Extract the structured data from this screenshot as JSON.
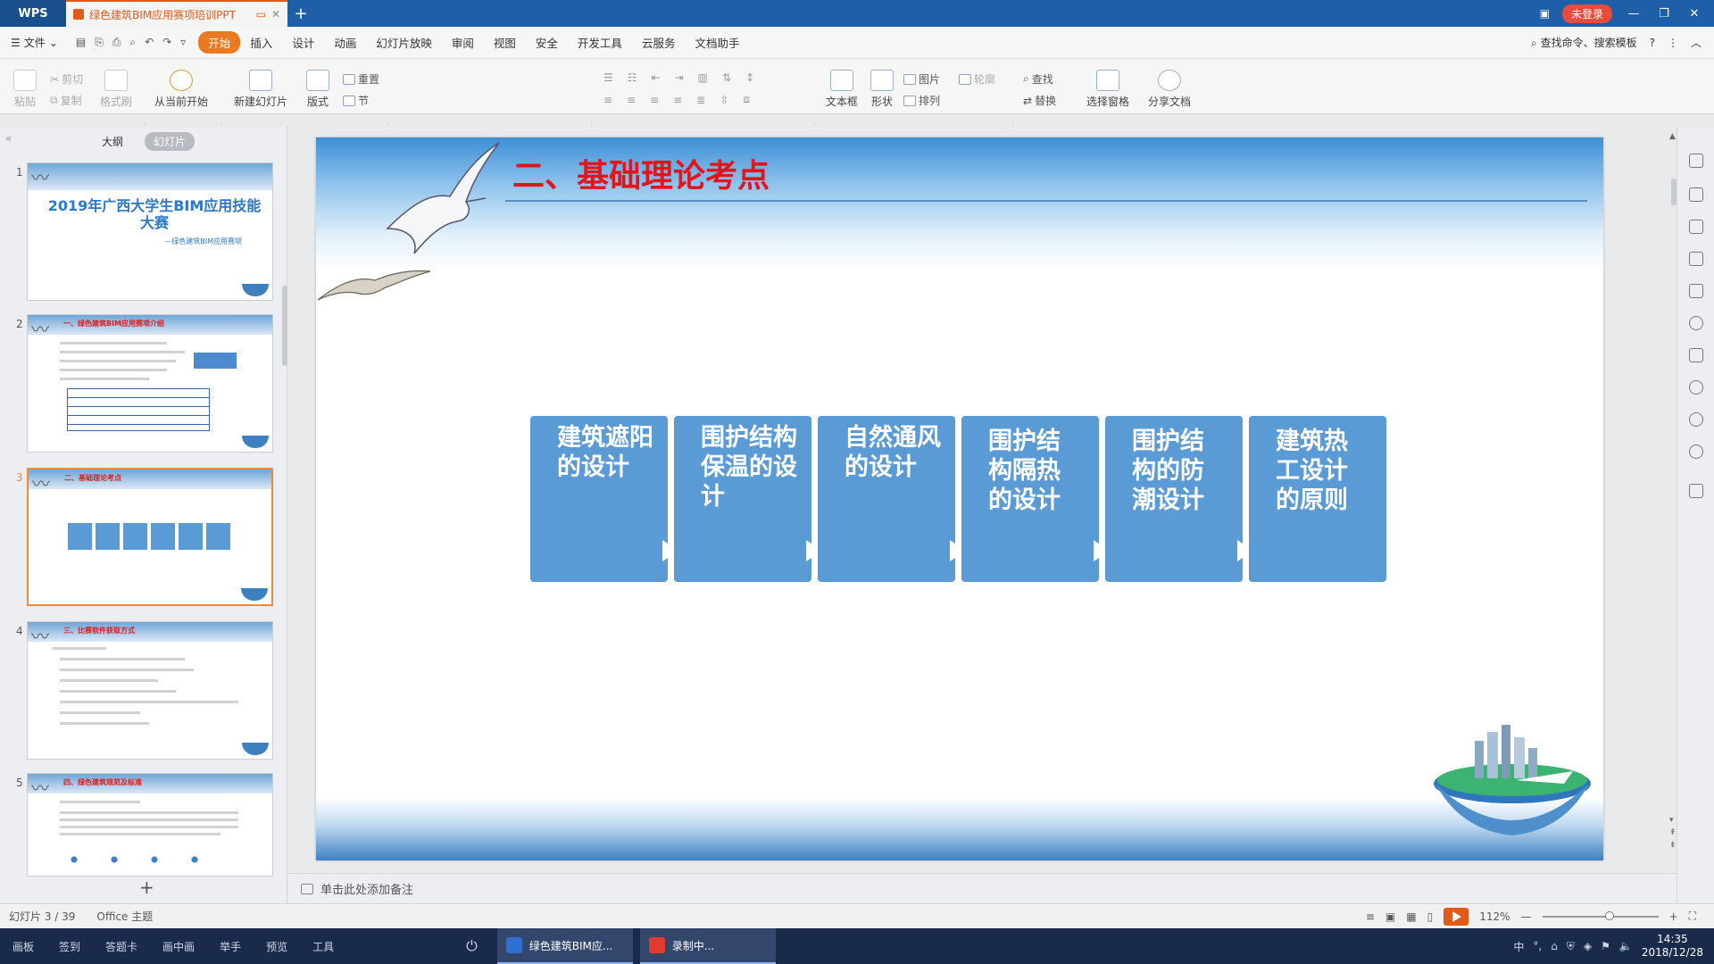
{
  "titlebar": {
    "app": "WPS",
    "doc_tab": "绿色建筑BIM应用赛项培训PPT",
    "login": "未登录"
  },
  "menu": {
    "file": "文件",
    "items": [
      "开始",
      "插入",
      "设计",
      "动画",
      "幻灯片放映",
      "审阅",
      "视图",
      "安全",
      "开发工具",
      "云服务",
      "文档助手"
    ],
    "search_cmd": "查找命令、搜索模板"
  },
  "ribbon": {
    "paste": "粘贴",
    "cut": "剪切",
    "copy": "复制",
    "format_painter": "格式刷",
    "from_current": "从当前开始",
    "new_slide": "新建幻灯片",
    "layout": "版式",
    "reset": "重置",
    "section": "节",
    "font_size": "0",
    "text_box": "文本框",
    "shape": "形状",
    "picture": "图片",
    "arrange": "排列",
    "outline": "轮廓",
    "find": "查找",
    "replace": "替换",
    "select_pane": "选择窗格",
    "share": "分享文档"
  },
  "left_panel": {
    "tab_outline": "大纲",
    "tab_slides": "幻灯片",
    "thumb1_title": "2019年广西大学生BIM应用技能大赛",
    "thumb1_sub": "—绿色建筑BIM应用赛项",
    "thumb2_title": "一、绿色建筑BIM应用赛项介绍",
    "thumb3_title": "二、基础理论考点",
    "thumb4_title": "三、比赛软件获取方式",
    "thumb5_title": "四、绿色建筑规范及标准"
  },
  "slide": {
    "title": "二、基础理论考点",
    "boxes": [
      "建筑遮阳的设计",
      "围护结构保温的设计",
      "自然通风的设计",
      "围护结构隔热的设计",
      "围护结构的防潮设计",
      "建筑热工设计的原则"
    ]
  },
  "notes_placeholder": "单击此处添加备注",
  "status": {
    "slide_count": "幻灯片 3 / 39",
    "theme": "Office 主题",
    "zoom": "112%"
  },
  "taskbar": {
    "items": [
      "画板",
      "签到",
      "答题卡",
      "画中画",
      "举手",
      "预览",
      "工具"
    ],
    "app1": "绿色建筑BIM应...",
    "app2": "录制中...",
    "time": "14:35",
    "date": "2018/12/28"
  },
  "colors": {
    "accent_orange": "#ea7a21",
    "title_red": "#e3151b",
    "box_blue": "#5b9bd5",
    "titlebar_blue": "#1f5fa8"
  }
}
